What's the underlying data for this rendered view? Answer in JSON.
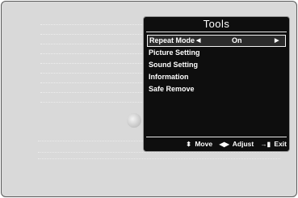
{
  "tools_menu": {
    "title": "Tools",
    "items": [
      {
        "label": "Repeat Mode",
        "value": "On",
        "selected": true
      },
      {
        "label": "Picture Setting"
      },
      {
        "label": "Sound Setting"
      },
      {
        "label": "Information"
      },
      {
        "label": "Safe Remove"
      }
    ],
    "footer": {
      "move_label": "Move",
      "adjust_label": "Adjust",
      "exit_label": "Exit"
    }
  },
  "icons": {
    "move": "up-down-arrows-icon",
    "adjust": "left-right-arrows-icon",
    "exit": "exit-icon"
  }
}
